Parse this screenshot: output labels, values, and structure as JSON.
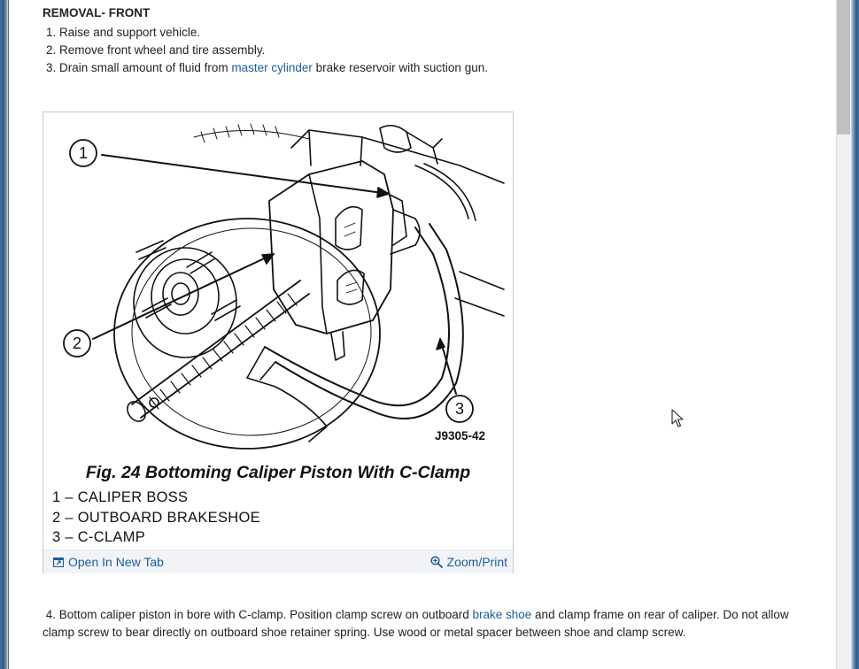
{
  "section": {
    "heading": "REMOVAL- FRONT",
    "steps": [
      {
        "text": "1. Raise and support vehicle."
      },
      {
        "text": "2. Remove front wheel and tire assembly."
      },
      {
        "pre": "3. Drain small amount of fluid from ",
        "link": "master cylinder",
        "post": " brake reservoir with suction gun."
      }
    ]
  },
  "figure": {
    "caption": "Fig. 24 Bottoming Caliper Piston With C-Clamp",
    "figure_id": "J9305-42",
    "callouts": [
      "1",
      "2",
      "3"
    ],
    "legend": [
      "1  –  CALIPER BOSS",
      "2  –  OUTBOARD BRAKESHOE",
      "3  –  C-CLAMP"
    ],
    "open_new_tab_label": "Open In New Tab",
    "zoom_print_label": "Zoom/Print"
  },
  "step4": {
    "pre": "4. Bottom caliper piston in bore with C-clamp. Position clamp screw on outboard ",
    "link": "brake shoe",
    "post": " and clamp frame on rear of caliper. Do not allow clamp screw to bear directly on outboard shoe retainer spring. Use wood or metal spacer between shoe and clamp screw."
  },
  "colors": {
    "link": "#1b5e9e",
    "text": "#222222",
    "toolbar_bg": "#f1f3f6"
  }
}
